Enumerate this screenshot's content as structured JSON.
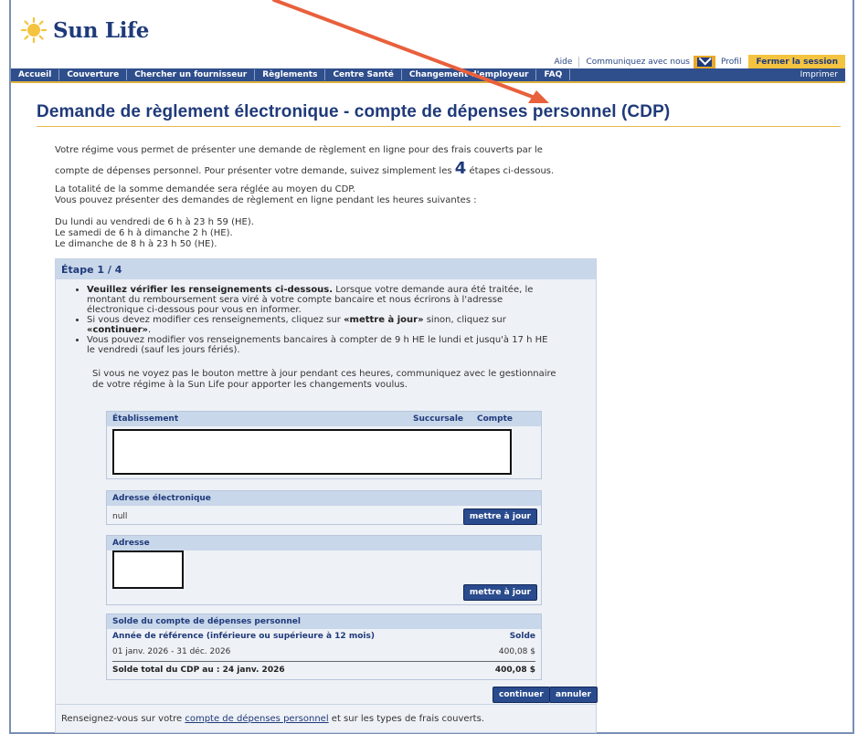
{
  "brand": {
    "name": "Sun Life"
  },
  "utility": {
    "help": "Aide",
    "contact": "Communiquez avec nous",
    "profile": "Profil",
    "logout": "Fermer la session"
  },
  "nav": {
    "items": [
      "Accueil",
      "Couverture",
      "Chercher un fournisseur",
      "Règlements",
      "Centre Santé",
      "Changement d'employeur",
      "FAQ"
    ],
    "print": "Imprimer"
  },
  "page": {
    "title": "Demande de règlement électronique - compte de dépenses personnel (CDP)"
  },
  "intro": {
    "line1": "Votre régime vous permet de présenter une demande de règlement en ligne pour des frais couverts par le",
    "line2_pre": "compte de dépenses personnel. Pour présenter votre demande, suivez simplement les ",
    "steps_count": "4",
    "line2_post": " étapes ci-dessous.",
    "para2a": "La totalité de la somme demandée sera réglée au moyen du CDP.",
    "para2b": "Vous pouvez présenter des demandes de règlement en ligne pendant les heures suivantes :",
    "hours1": "Du lundi au vendredi de 6 h à 23 h 59 (HE).",
    "hours2": "Le samedi de 6 h à dimanche 2 h (HE).",
    "hours3": "Le dimanche de 8 h à 23 h 50 (HE)."
  },
  "step": {
    "header": "Étape 1 / 4",
    "b1_bold": "Veuillez vérifier les renseignements ci-dessous.",
    "b1_rest_a": " Lorsque votre demande aura été traitée, le",
    "b1_rest_b": "montant du remboursement sera viré à votre compte bancaire et nous écrirons à l'adresse",
    "b1_rest_c": "électronique ci-dessous pour vous en informer.",
    "b2_a": "Si vous devez modifier ces renseignements, cliquez sur ",
    "b2_bold1": "«mettre à jour»",
    "b2_b": " sinon, cliquez sur",
    "b2_bold2": "«continuer»",
    "b2_c": ".",
    "b3_a": "Vous pouvez modifier vos renseignements bancaires à compter de 9 h HE le lundi et jusqu'à 17 h HE",
    "b3_b": "le vendredi (sauf les jours fériés).",
    "note_a": "Si vous ne voyez pas le bouton mettre à jour pendant ces heures, communiquez avec le gestionnaire",
    "note_b": "de votre régime à la Sun Life pour apporter les changements voulus."
  },
  "bank": {
    "col1": "Établissement",
    "col2": "Succursale",
    "col3": "Compte"
  },
  "email": {
    "label": "Adresse électronique",
    "value": "null",
    "update": "mettre à jour"
  },
  "address": {
    "label": "Adresse",
    "update": "mettre à jour"
  },
  "balance": {
    "title": "Solde du compte de dépenses personnel",
    "col1": "Année de référence (inférieure ou supérieure à 12 mois)",
    "col2": "Solde",
    "period": "01 janv. 2026 - 31 déc. 2026",
    "amount": "400,08 $",
    "total_label": "Solde total du CDP au : 24 janv. 2026",
    "total_amount": "400,08 $"
  },
  "actions": {
    "continue": "continuer",
    "cancel": "annuler"
  },
  "footer": {
    "pre": "Renseignez-vous sur votre ",
    "link": "compte de dépenses personnel",
    "post": " et sur les types de frais couverts."
  },
  "colors": {
    "brand_blue": "#2f4e8c",
    "accent_gold": "#f4c33f",
    "annotation_arrow": "#e8603c"
  }
}
